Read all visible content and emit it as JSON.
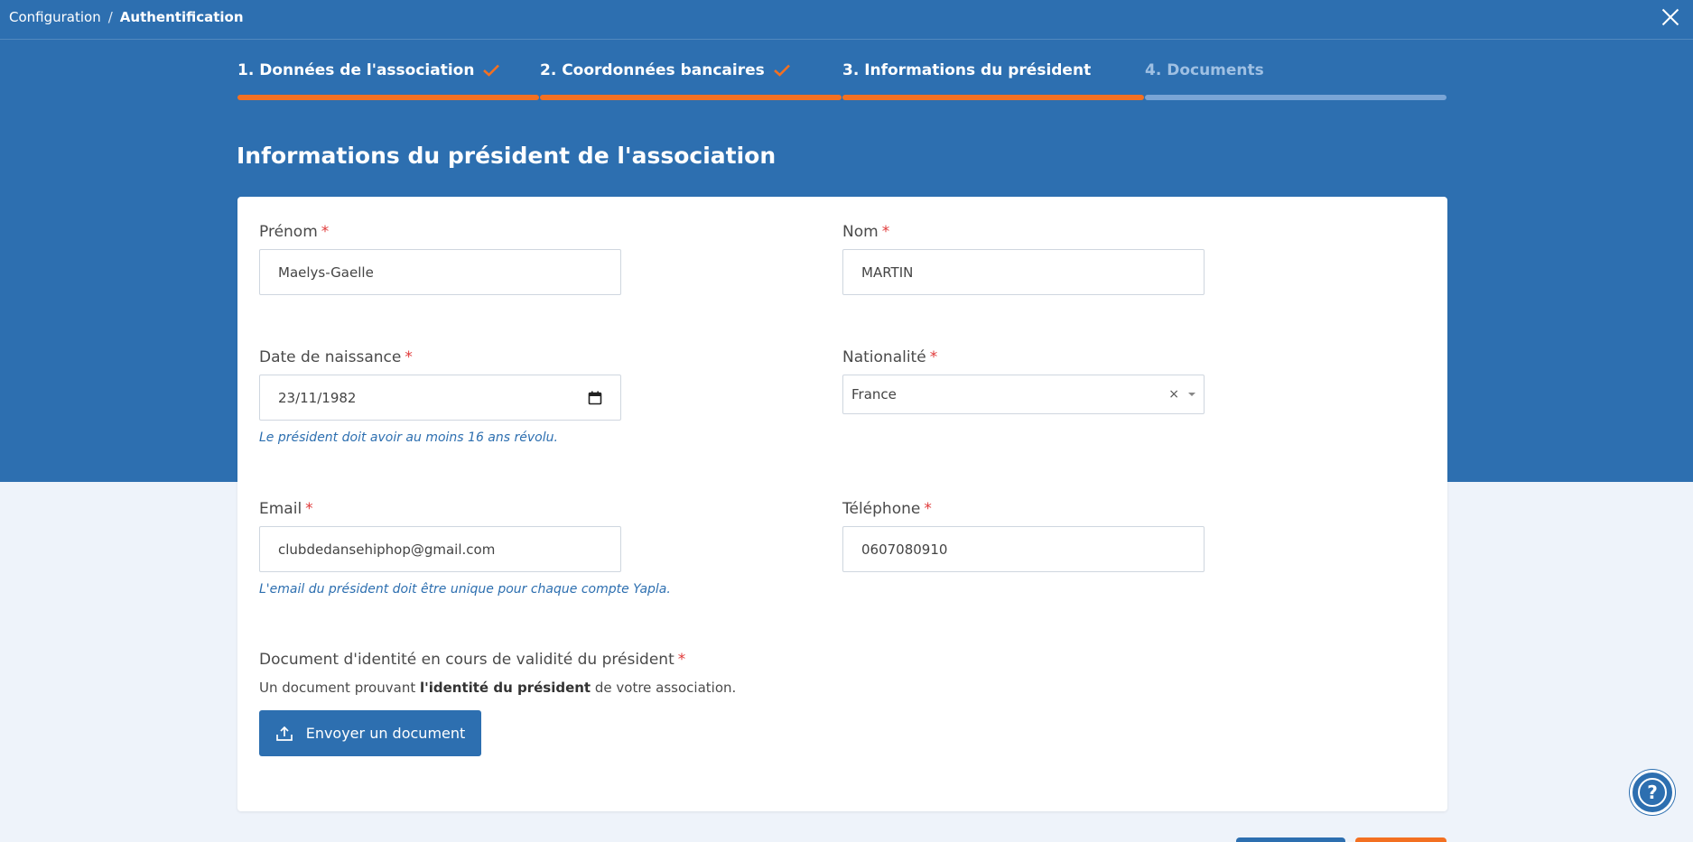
{
  "breadcrumb": {
    "parent": "Configuration",
    "separator": "/",
    "current": "Authentification"
  },
  "steps": [
    {
      "label": "1. Données de l'association",
      "done": true
    },
    {
      "label": "2. Coordonnées bancaires",
      "done": true
    },
    {
      "label": "3. Informations du président",
      "done": false
    },
    {
      "label": "4. Documents",
      "done": false
    }
  ],
  "page_title": "Informations du président de l'association",
  "form": {
    "prenom": {
      "label": "Prénom",
      "value": "Maelys-Gaelle"
    },
    "nom": {
      "label": "Nom",
      "value": "MARTIN"
    },
    "date_naissance": {
      "label": "Date de naissance",
      "value": "23/11/1982",
      "hint": "Le président doit avoir au moins 16 ans révolu."
    },
    "nationalite": {
      "label": "Nationalité",
      "value": "France",
      "clear": "×"
    },
    "email": {
      "label": "Email",
      "value": "clubdedansehiphop@gmail.com",
      "hint": "L'email du président doit être unique pour chaque compte Yapla."
    },
    "telephone": {
      "label": "Téléphone",
      "value": "0607080910"
    },
    "required_mark": "*"
  },
  "document": {
    "label": "Document d'identité en cours de validité du président",
    "desc_prefix": "Un document prouvant ",
    "desc_bold": "l'identité du président",
    "desc_suffix": " de votre association.",
    "upload_label": "Envoyer un document"
  },
  "help": {
    "icon": "question-icon",
    "glyph": "?"
  },
  "colors": {
    "primary": "#2d6fb0",
    "accent": "#f37021",
    "required": "#e03a3a",
    "background": "#eef3fa"
  }
}
